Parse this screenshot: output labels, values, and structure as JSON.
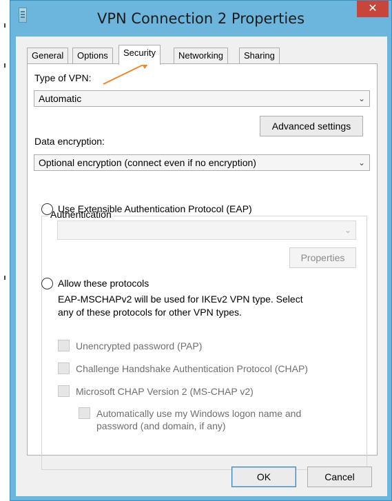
{
  "window": {
    "title": "VPN Connection 2 Properties",
    "close_glyph": "✕"
  },
  "tabs": [
    {
      "label": "General",
      "active": false
    },
    {
      "label": "Options",
      "active": false
    },
    {
      "label": "Security",
      "active": true
    },
    {
      "label": "Networking",
      "active": false
    },
    {
      "label": "Sharing",
      "active": false
    }
  ],
  "security": {
    "type_label": "Type of VPN:",
    "type_value": "Automatic",
    "advanced_button": "Advanced settings",
    "encryption_label": "Data encryption:",
    "encryption_value": "Optional encryption (connect even if no encryption)",
    "auth_group_label": "Authentication",
    "eap_radio_label": "Use Extensible Authentication Protocol (EAP)",
    "eap_dropdown_value": "",
    "properties_button": "Properties",
    "allow_radio_label": "Allow these protocols",
    "note_line1": "EAP-MSCHAPv2 will be used for IKEv2 VPN type. Select",
    "note_line2": "any of these protocols for other VPN types.",
    "pap_label": "Unencrypted password (PAP)",
    "chap_label": "Challenge Handshake Authentication Protocol (CHAP)",
    "mschap_label": "Microsoft CHAP Version 2 (MS-CHAP v2)",
    "auto_logon_line1": "Automatically use my Windows logon name and",
    "auto_logon_line2": "password (and domain, if any)"
  },
  "footer": {
    "ok": "OK",
    "cancel": "Cancel"
  },
  "icons": {
    "dropdown_chevron": "chevron-down-icon",
    "annotation_arrow": "arrow-annotation"
  },
  "colors": {
    "title_bar": "#6cb6dd",
    "close_button": "#c7453b",
    "annotation": "#f0862a"
  }
}
